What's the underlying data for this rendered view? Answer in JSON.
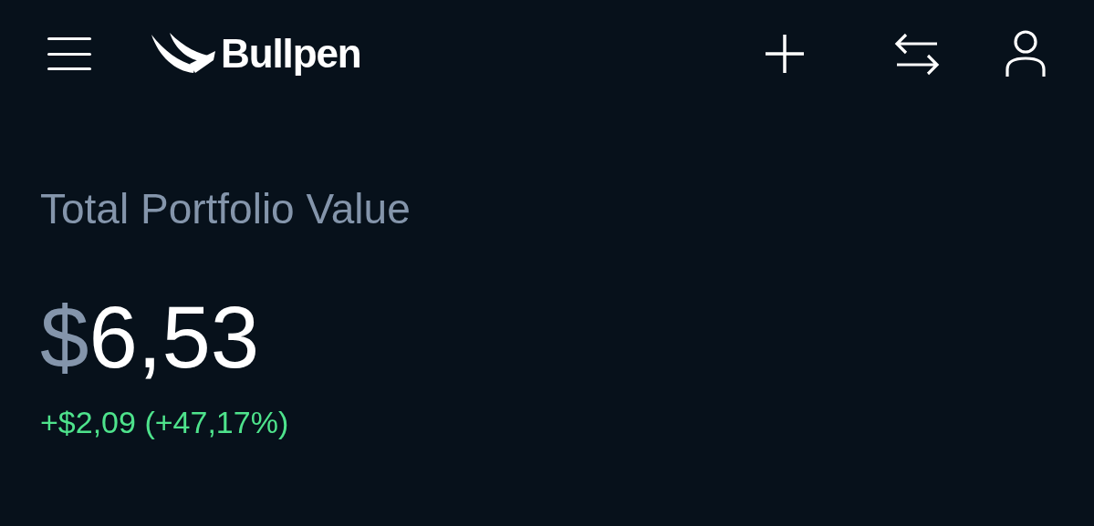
{
  "header": {
    "brand": "Bullpen"
  },
  "portfolio": {
    "label": "Total Portfolio Value",
    "currency_symbol": "$",
    "amount": "6,53",
    "change": "+$2,09 (+47,17%)",
    "positive": true
  }
}
